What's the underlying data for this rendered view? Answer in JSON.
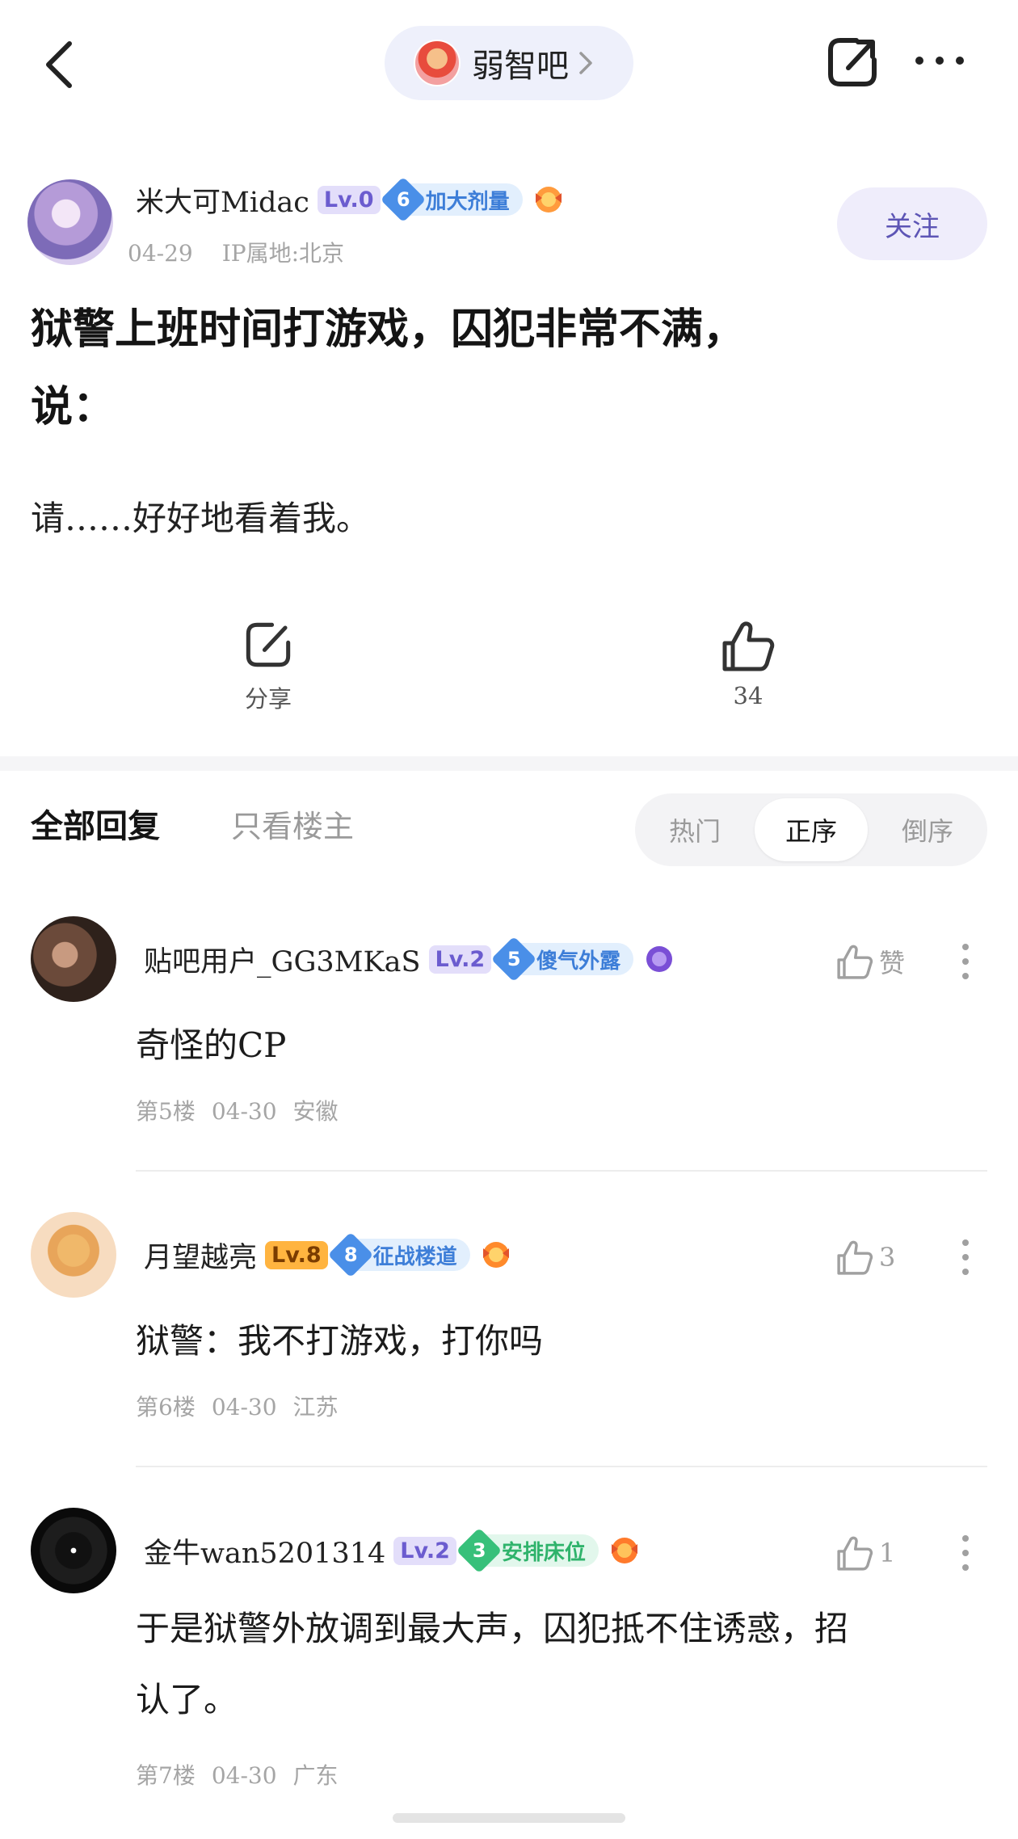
{
  "header": {
    "forum_name": "弱智吧"
  },
  "post": {
    "author": {
      "name": "米大可Midac",
      "level": "Lv.0",
      "title_level": "6",
      "title_text": "加大剂量",
      "date": "04-29",
      "ip": "IP属地:北京"
    },
    "follow_label": "关注",
    "title_line1": "狱警上班时间打游戏，囚犯非常不满，",
    "title_line2": "说：",
    "body": "请……好好地看着我。",
    "share_label": "分享",
    "like_count": "34"
  },
  "filters": {
    "all_replies": "全部回复",
    "op_only": "只看楼主",
    "sort_hot": "热门",
    "sort_asc": "正序",
    "sort_desc": "倒序",
    "selected": "正序"
  },
  "replies": [
    {
      "name": "贴吧用户_GG3MKaS",
      "level": "Lv.2",
      "title_level": "5",
      "title_text": "傻气外露",
      "like": "赞",
      "content": "奇怪的CP",
      "floor": "第5楼",
      "date": "04-30",
      "location": "安徽"
    },
    {
      "name": "月望越亮",
      "level": "Lv.8",
      "title_level": "8",
      "title_text": "征战楼道",
      "like": "3",
      "content": "狱警：我不打游戏，打你吗",
      "floor": "第6楼",
      "date": "04-30",
      "location": "江苏"
    },
    {
      "name": "金牛wan5201314",
      "level": "Lv.2",
      "title_level": "3",
      "title_text": "安排床位",
      "like": "1",
      "content_line1": "于是狱警外放调到最大声，囚犯抵不住诱惑，招",
      "content_line2": "认了。",
      "floor": "第7楼",
      "date": "04-30",
      "location": "广东"
    }
  ],
  "colors": {
    "accent_purple": "#5d55b5",
    "badge_blue": "#4a8fe8",
    "badge_green": "#37c07a",
    "level_orange": "#ffb440"
  }
}
